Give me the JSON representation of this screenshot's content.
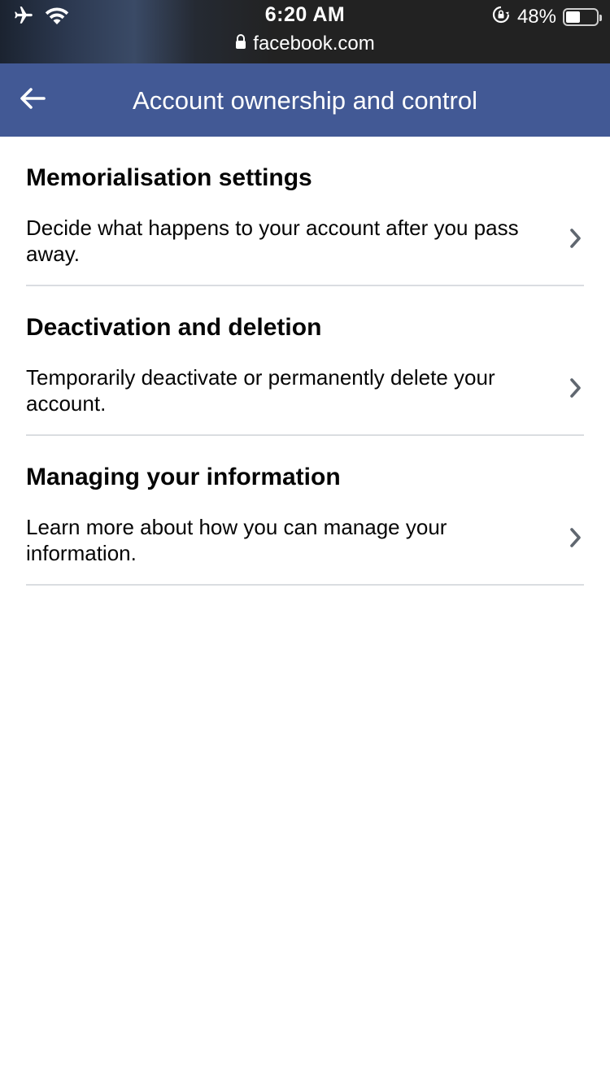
{
  "status_bar": {
    "time": "6:20 AM",
    "battery_percent": "48%",
    "battery_level": 0.48,
    "icons": [
      "airplane-icon",
      "wifi-icon",
      "orientation-lock-icon",
      "battery-icon"
    ]
  },
  "browser": {
    "url": "facebook.com",
    "icon": "lock-icon"
  },
  "header": {
    "title": "Account ownership and control",
    "back_icon": "back-arrow-icon",
    "color": "#425995"
  },
  "items": [
    {
      "title": "Memorialisation settings",
      "description": "Decide what happens to your account after you pass away.",
      "icon": "chevron-right-icon"
    },
    {
      "title": "Deactivation and deletion",
      "description": "Temporarily deactivate or permanently delete your account.",
      "icon": "chevron-right-icon"
    },
    {
      "title": "Managing your information",
      "description": "Learn more about how you can manage your information.",
      "icon": "chevron-right-icon"
    }
  ]
}
